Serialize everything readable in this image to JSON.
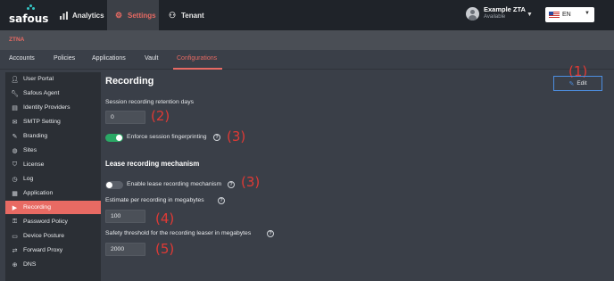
{
  "topnav": {
    "brand": "safous",
    "tabs": [
      {
        "label": "Analytics",
        "icon": "analytics-icon"
      },
      {
        "label": "Settings",
        "icon": "gear-icon"
      },
      {
        "label": "Tenant",
        "icon": "tenant-icon"
      }
    ],
    "user": {
      "name": "Example ZTA",
      "status": "Available"
    },
    "language": "EN"
  },
  "section": "ZTNA",
  "subtabs": [
    "Accounts",
    "Policies",
    "Applications",
    "Vault",
    "Configurations"
  ],
  "active_subtab": "Configurations",
  "sidebar": {
    "items": [
      {
        "label": "User Portal",
        "icon": "user-icon"
      },
      {
        "label": "Safous Agent",
        "icon": "wrench-icon"
      },
      {
        "label": "Identity Providers",
        "icon": "id-card-icon"
      },
      {
        "label": "SMTP Setting",
        "icon": "mail-icon"
      },
      {
        "label": "Branding",
        "icon": "brush-icon"
      },
      {
        "label": "Sites",
        "icon": "globe-icon"
      },
      {
        "label": "License",
        "icon": "shield-icon"
      },
      {
        "label": "Log",
        "icon": "log-icon"
      },
      {
        "label": "Application",
        "icon": "app-icon"
      },
      {
        "label": "Recording",
        "icon": "video-icon"
      },
      {
        "label": "Password Policy",
        "icon": "key-icon"
      },
      {
        "label": "Device Posture",
        "icon": "device-icon"
      },
      {
        "label": "Forward Proxy",
        "icon": "proxy-icon"
      },
      {
        "label": "DNS",
        "icon": "dns-icon"
      }
    ],
    "active": "Recording"
  },
  "main": {
    "title": "Recording",
    "edit_label": "Edit",
    "retention_label": "Session recording retention days",
    "retention_value": "0",
    "fingerprint_label": "Enforce session fingerprinting",
    "fingerprint_on": true,
    "lease_heading": "Lease recording mechanism",
    "lease_label": "Enable lease recording mechanism",
    "lease_on": false,
    "estimate_label": "Estimate per recording in megabytes",
    "estimate_value": "100",
    "threshold_label": "Safety threshold for the recording leaser in megabytes",
    "threshold_value": "2000"
  },
  "annotations": {
    "a1": "(1)",
    "a2": "(2)",
    "a3": "(3)",
    "a3b": "(3)",
    "a4": "(4)",
    "a5": "(5)"
  },
  "colors": {
    "accent": "#e86a63",
    "toggle_on": "#2aa865",
    "annotation": "#e03a35",
    "edit_border": "#4d8ee0"
  }
}
